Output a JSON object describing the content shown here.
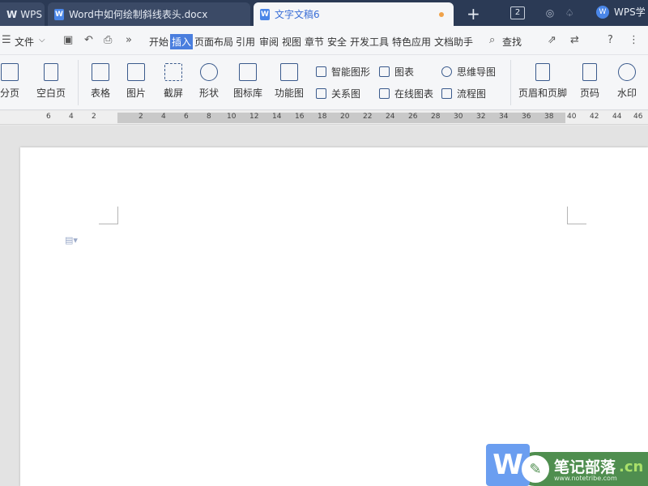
{
  "tabs": {
    "wps": "WPS",
    "doc1": "Word中如何绘制斜线表头.docx",
    "doc2": "文字文稿6",
    "new_tab": "+",
    "window_count": "2",
    "wps_account": "WPS学"
  },
  "menu": {
    "file": "文件",
    "more": "»",
    "items": [
      "开始",
      "插入",
      "页面布局",
      "引用",
      "审阅",
      "视图",
      "章节",
      "安全",
      "开发工具",
      "特色应用",
      "文档助手"
    ],
    "active": "插入",
    "search": "查找",
    "help": "?",
    "more_menu": "⋮"
  },
  "ribbon": {
    "page_break": "分页",
    "blank_page": "空白页",
    "table": "表格",
    "picture": "图片",
    "screenshot": "截屏",
    "shape": "形状",
    "icon_lib": "图标库",
    "function_chart": "功能图",
    "smart_shape": "智能图形",
    "relation_chart": "关系图",
    "chart": "图表",
    "online_chart": "在线图表",
    "mind_map": "思维导图",
    "flowchart": "流程图",
    "header_footer": "页眉和页脚",
    "page_number": "页码",
    "watermark": "水印"
  },
  "ruler": {
    "left_numbers": [
      "6",
      "4",
      "2"
    ],
    "right_numbers": [
      "2",
      "4",
      "6",
      "8",
      "10",
      "12",
      "14",
      "16",
      "18",
      "20",
      "22",
      "24",
      "26",
      "28",
      "30",
      "32",
      "34",
      "36",
      "38",
      "40",
      "42",
      "44",
      "46"
    ]
  },
  "watermark_logo": {
    "letter": "W",
    "title": "笔记部落",
    "url": "www.notetribe.com",
    "suffix": ".cn"
  }
}
